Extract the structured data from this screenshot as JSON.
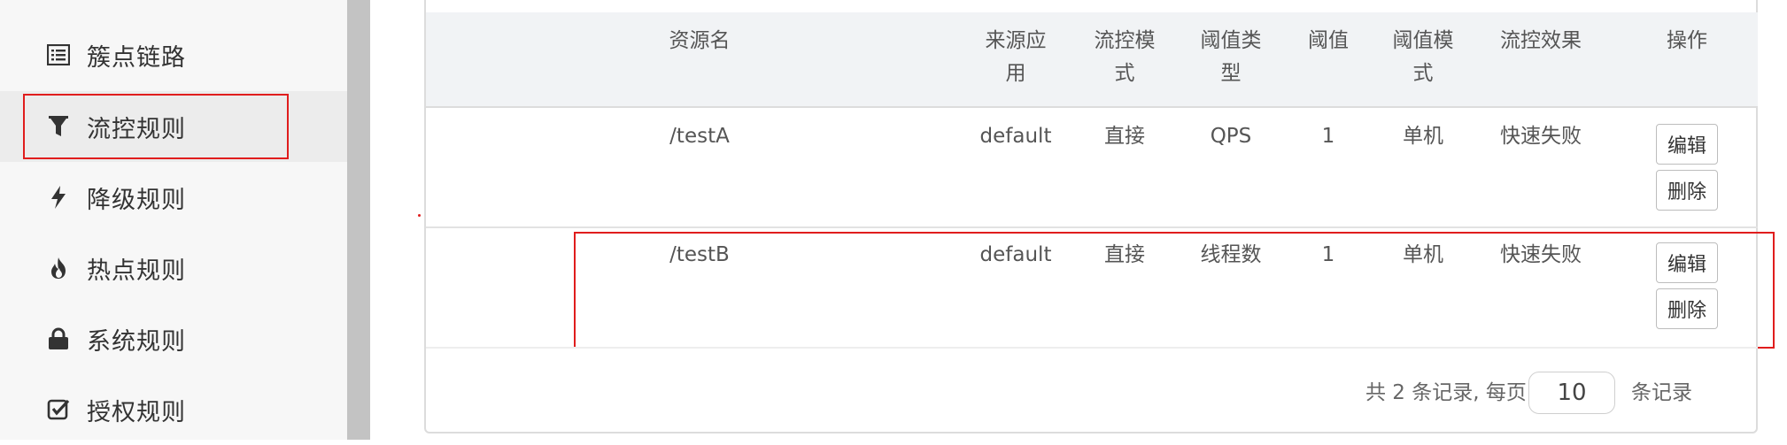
{
  "sidebar": {
    "items": [
      {
        "label": "簇点链路",
        "icon": "list-icon"
      },
      {
        "label": "流控规则",
        "icon": "filter-icon",
        "active": true
      },
      {
        "label": "降级规则",
        "icon": "bolt-icon"
      },
      {
        "label": "热点规则",
        "icon": "fire-icon"
      },
      {
        "label": "系统规则",
        "icon": "lock-icon"
      },
      {
        "label": "授权规则",
        "icon": "check-square-icon"
      }
    ]
  },
  "table": {
    "headers": {
      "resource": "资源名",
      "limit_app_1": "来源应",
      "limit_app_2": "用",
      "mode_1": "流控模",
      "mode_2": "式",
      "grade_1": "阈值类",
      "grade_2": "型",
      "count": "阈值",
      "cluster_1": "阈值模",
      "cluster_2": "式",
      "effect": "流控效果",
      "action": "操作"
    },
    "rows": [
      {
        "resource": "/testA",
        "limit_app": "default",
        "mode": "直接",
        "grade": "QPS",
        "count": "1",
        "cluster": "单机",
        "effect": "快速失败",
        "edit_label": "编辑",
        "delete_label": "删除"
      },
      {
        "resource": "/testB",
        "limit_app": "default",
        "mode": "直接",
        "grade": "线程数",
        "count": "1",
        "cluster": "单机",
        "effect": "快速失败",
        "edit_label": "编辑",
        "delete_label": "删除"
      }
    ]
  },
  "pagination": {
    "summary": "共 2 条记录, 每页",
    "page_size": "10",
    "suffix": "条记录"
  },
  "colors": {
    "highlight": "#e01d1d",
    "header_bg": "#f1f3f5",
    "sidebar_bg": "#f7f7f7"
  }
}
